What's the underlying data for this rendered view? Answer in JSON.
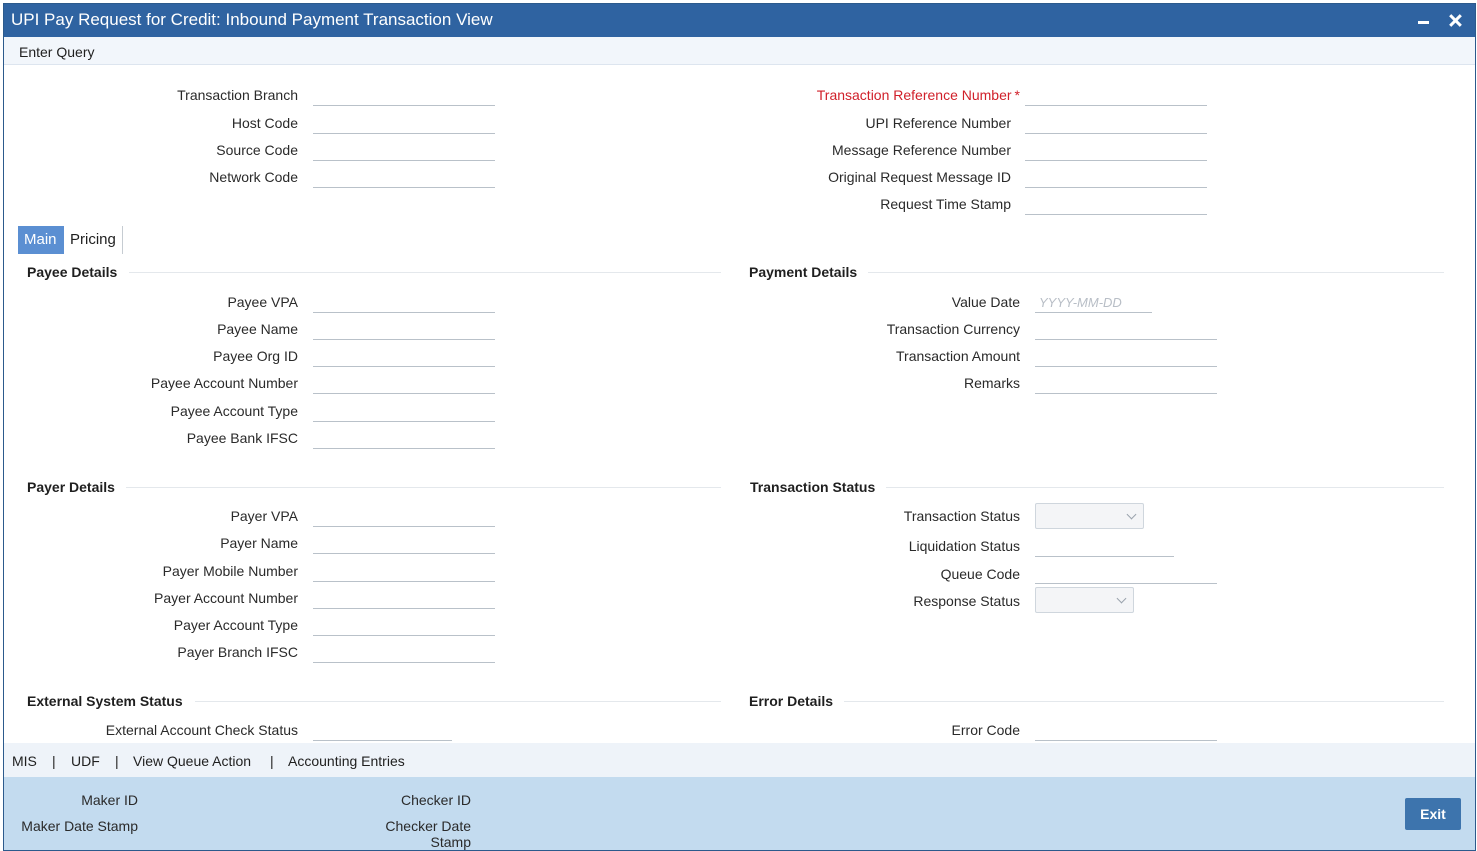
{
  "window": {
    "title": "UPI Pay Request for Credit: Inbound Payment Transaction View"
  },
  "menu": {
    "enter_query": "Enter Query"
  },
  "header_fields": {
    "transaction_branch": {
      "label": "Transaction Branch",
      "value": ""
    },
    "host_code": {
      "label": "Host Code",
      "value": ""
    },
    "source_code": {
      "label": "Source Code",
      "value": ""
    },
    "network_code": {
      "label": "Network Code",
      "value": ""
    },
    "transaction_reference_number": {
      "label": "Transaction Reference Number",
      "required_marker": "*",
      "value": ""
    },
    "upi_reference_number": {
      "label": "UPI Reference Number",
      "value": ""
    },
    "message_reference_number": {
      "label": "Message Reference Number",
      "value": ""
    },
    "original_request_message_id": {
      "label": "Original Request Message ID",
      "value": ""
    },
    "request_time_stamp": {
      "label": "Request Time Stamp",
      "value": ""
    }
  },
  "tabs": [
    {
      "label": "Main",
      "active": true
    },
    {
      "label": "Pricing",
      "active": false
    }
  ],
  "payee_details": {
    "title": "Payee Details",
    "fields": [
      {
        "label": "Payee VPA",
        "value": ""
      },
      {
        "label": "Payee Name",
        "value": ""
      },
      {
        "label": "Payee Org ID",
        "value": ""
      },
      {
        "label": "Payee Account Number",
        "value": ""
      },
      {
        "label": "Payee Account Type",
        "value": ""
      },
      {
        "label": "Payee Bank IFSC",
        "value": ""
      }
    ]
  },
  "payment_details": {
    "title": "Payment Details",
    "value_date": {
      "label": "Value Date",
      "placeholder": "YYYY-MM-DD",
      "value": ""
    },
    "transaction_currency": {
      "label": "Transaction Currency",
      "value": ""
    },
    "transaction_amount": {
      "label": "Transaction Amount",
      "value": ""
    },
    "remarks": {
      "label": "Remarks",
      "value": ""
    }
  },
  "payer_details": {
    "title": "Payer Details",
    "fields": [
      {
        "label": "Payer VPA",
        "value": ""
      },
      {
        "label": "Payer Name",
        "value": ""
      },
      {
        "label": "Payer Mobile Number",
        "value": ""
      },
      {
        "label": "Payer Account Number",
        "value": ""
      },
      {
        "label": "Payer Account Type",
        "value": ""
      },
      {
        "label": "Payer Branch IFSC",
        "value": ""
      }
    ]
  },
  "transaction_status": {
    "title": "Transaction Status",
    "transaction_status": {
      "label": "Transaction Status",
      "value": ""
    },
    "liquidation_status": {
      "label": "Liquidation Status",
      "value": ""
    },
    "queue_code": {
      "label": "Queue Code",
      "value": ""
    },
    "response_status": {
      "label": "Response Status",
      "value": ""
    }
  },
  "external_system_status": {
    "title": "External System Status",
    "external_account_check_status": {
      "label": "External Account Check Status",
      "value": ""
    }
  },
  "error_details": {
    "title": "Error Details",
    "error_code": {
      "label": "Error Code",
      "value": ""
    }
  },
  "bottom_links": {
    "mis": "MIS",
    "udf": "UDF",
    "view_queue_action": "View Queue Action",
    "accounting_entries": "Accounting Entries",
    "separator": "|"
  },
  "footer": {
    "maker_id": "Maker ID",
    "maker_date_stamp": "Maker Date Stamp",
    "checker_id": "Checker ID",
    "checker_date_stamp_line1": "Checker Date",
    "checker_date_stamp_line2": "Stamp",
    "exit": "Exit"
  }
}
